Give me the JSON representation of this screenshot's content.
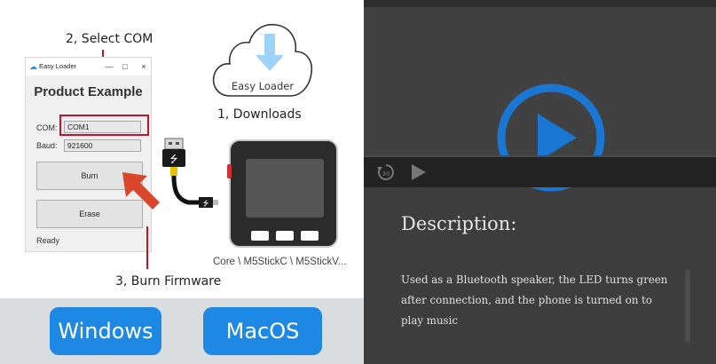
{
  "steps": {
    "select_com": "2, Select COM",
    "downloads": "1, Downloads",
    "burn_firmware": "3, Burn Firmware"
  },
  "easy_loader": {
    "window_title": "Easy Loader",
    "minimize": "—",
    "maximize": "□",
    "close": "×",
    "product_title": "Product Example",
    "com_label": "COM:",
    "com_value": "COM1",
    "baud_label": "Baud:",
    "baud_value": "921600",
    "burn_button": "Burn",
    "erase_button": "Erase",
    "status": "Ready"
  },
  "cloud": {
    "label": "Easy Loader"
  },
  "device": {
    "caption": "Core \\ M5StickC \\ M5StickV..."
  },
  "os_buttons": {
    "windows": "Windows",
    "macos": "MacOS"
  },
  "video": {
    "rewind_label": "30"
  },
  "description": {
    "title": "Description:",
    "text": "Used as a Bluetooth speaker, the LED turns green after connection, and the phone is turned on to play music"
  },
  "colors": {
    "accent_blue": "#1e88e5",
    "highlight_red": "#c8102e",
    "play_blue": "#1976d2"
  }
}
